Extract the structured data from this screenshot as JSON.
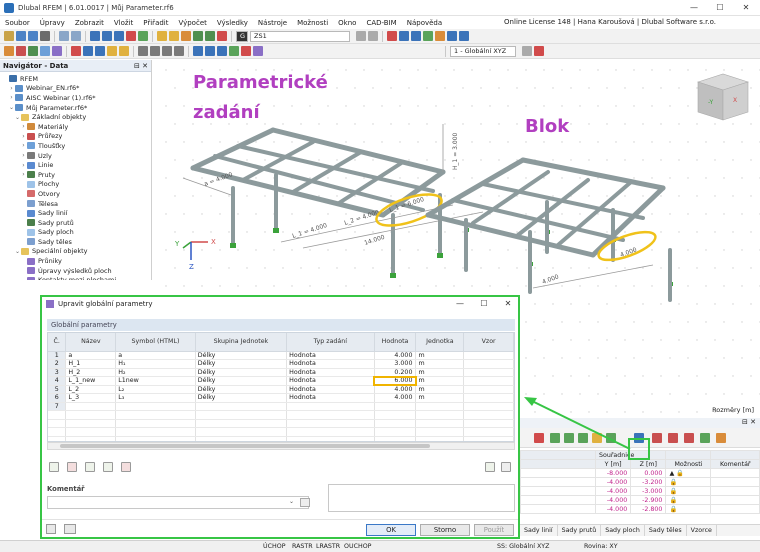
{
  "window": {
    "title": "Dlubal RFEM | 6.01.0017 | Můj Parameter.rf6",
    "license": "Online License 148 | Hana Karoušová | Dlubal Software s.r.o."
  },
  "menu": [
    "Soubor",
    "Úpravy",
    "Zobrazit",
    "Vložit",
    "Přiřadit",
    "Výpočet",
    "Výsledky",
    "Nástroje",
    "Možnosti",
    "Okno",
    "CAD-BIM",
    "Nápověda"
  ],
  "toolbar": {
    "load_case_tag": "G",
    "load_case": "ZS1",
    "view_combo": "1 - Globální XYZ"
  },
  "navigator": {
    "title": "Navigátor - Data",
    "items": [
      {
        "label": "RFEM",
        "arrow": "",
        "color": "#3a6ea8"
      },
      {
        "label": "Webinar_EN.rf6*",
        "arrow": "›",
        "color": "#5b8fc9"
      },
      {
        "label": "AISC Webinar (1).rf6*",
        "arrow": "›",
        "color": "#5b8fc9"
      },
      {
        "label": "Můj Parameter.rf6*",
        "arrow": "⌄",
        "color": "#5b8fc9"
      },
      {
        "label": "Základní objekty",
        "arrow": "⌄",
        "color": "#e6c35c"
      },
      {
        "label": "Materiály",
        "arrow": "›",
        "color": "#d08a3c"
      },
      {
        "label": "Průřezy",
        "arrow": "›",
        "color": "#c94f4f"
      },
      {
        "label": "Tloušťky",
        "arrow": "›",
        "color": "#6ea0d8"
      },
      {
        "label": "Uzly",
        "arrow": "›",
        "color": "#7a7a7a"
      },
      {
        "label": "Linie",
        "arrow": "›",
        "color": "#5a8ad0"
      },
      {
        "label": "Pruty",
        "arrow": "›",
        "color": "#4b7f4b"
      },
      {
        "label": "Plochy",
        "arrow": "",
        "color": "#9ec3e8"
      },
      {
        "label": "Otvory",
        "arrow": "",
        "color": "#d56a6a"
      },
      {
        "label": "Tělesa",
        "arrow": "",
        "color": "#7c9fcf"
      },
      {
        "label": "Sady linií",
        "arrow": "",
        "color": "#5a8ad0"
      },
      {
        "label": "Sady prutů",
        "arrow": "",
        "color": "#4b7f4b"
      },
      {
        "label": "Sady ploch",
        "arrow": "",
        "color": "#9ec3e8"
      },
      {
        "label": "Sady těles",
        "arrow": "",
        "color": "#7c9fcf"
      },
      {
        "label": "Speciální objekty",
        "arrow": "⌄",
        "color": "#e6c35c"
      },
      {
        "label": "Průniky",
        "arrow": "",
        "color": "#8a6fc6"
      },
      {
        "label": "Úpravy výsledků ploch",
        "arrow": "",
        "color": "#8a6fc6"
      },
      {
        "label": "Kontakty mezi plochami",
        "arrow": "",
        "color": "#8a6fc6"
      }
    ]
  },
  "viewport": {
    "label_left_line1": "Parametrické",
    "label_left_line2": "zadání",
    "label_right": "Blok",
    "dims": {
      "a": "a = 4.000",
      "h1": "H_1 = 3.000",
      "l1new": "L_1 = 6.000",
      "l1": "L_1 = 4.000",
      "l2": "L_2 = 4.000",
      "l3": "L_3 = 4.000",
      "total": "14.000",
      "blok_w": "4.000",
      "blok_d1": "4.000",
      "blok_d2": "4.000",
      "blok_6": "6.000"
    },
    "axes": {
      "x": "X",
      "y": "Y",
      "z": "Z"
    },
    "scale_note": "Rozměry [m]"
  },
  "dialog": {
    "title": "Upravit globální parametry",
    "section": "Globální parametry",
    "columns": [
      "Č.",
      "Název",
      "Symbol (HTML)",
      "Skupina Jednotek",
      "Typ zadání",
      "Hodnota",
      "Jednotka",
      "Vzor"
    ],
    "rows": [
      {
        "no": "1",
        "name": "a",
        "symbol": "a",
        "group": "Délky",
        "type": "Hodnota",
        "value": "4.000",
        "unit": "m"
      },
      {
        "no": "2",
        "name": "H_1",
        "symbol": "H₁",
        "group": "Délky",
        "type": "Hodnota",
        "value": "3.000",
        "unit": "m"
      },
      {
        "no": "3",
        "name": "H_2",
        "symbol": "H₂",
        "group": "Délky",
        "type": "Hodnota",
        "value": "0.200",
        "unit": "m"
      },
      {
        "no": "4",
        "name": "L_1_new",
        "symbol": "L1new",
        "group": "Délky",
        "type": "Hodnota",
        "value": "6.000",
        "unit": "m"
      },
      {
        "no": "5",
        "name": "L_2",
        "symbol": "L₂",
        "group": "Délky",
        "type": "Hodnota",
        "value": "4.000",
        "unit": "m"
      },
      {
        "no": "6",
        "name": "L_3",
        "symbol": "L₃",
        "group": "Délky",
        "type": "Hodnota",
        "value": "4.000",
        "unit": "m"
      },
      {
        "no": "7",
        "name": "",
        "symbol": "",
        "group": "",
        "type": "",
        "value": "",
        "unit": ""
      }
    ],
    "comment_label": "Komentář",
    "buttons": {
      "ok": "OK",
      "cancel": "Storno",
      "apply": "Použít"
    }
  },
  "bottom_table": {
    "col_group": "Souřadnice",
    "columns": [
      "Y [m]",
      "Z [m]",
      "Možnosti",
      "Komentář"
    ],
    "rows": [
      {
        "y": "-8.000",
        "z": "0.000"
      },
      {
        "y": "-4.000",
        "z": "-3.200"
      },
      {
        "y": "-4.000",
        "z": "-3.000"
      },
      {
        "y": "-4.000",
        "z": "-2.900"
      },
      {
        "y": "-4.000",
        "z": "-2.800"
      }
    ],
    "tabs": [
      "Sady linií",
      "Sady prutů",
      "Sady ploch",
      "Sady těles",
      "Vzorce"
    ]
  },
  "status": {
    "snaps": [
      "ÚCHOP",
      "RASTR",
      "LRASTR",
      "OUCHOP"
    ],
    "cs": "SS: Globální XYZ",
    "plane": "Rovina: XY"
  }
}
